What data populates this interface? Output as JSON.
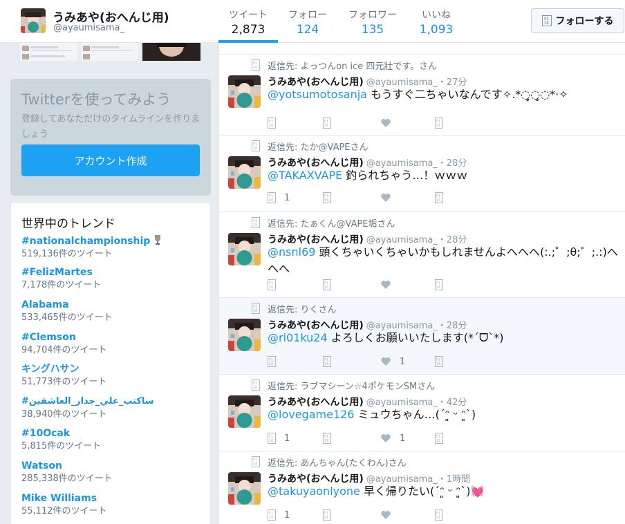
{
  "profile": {
    "name": "うみあや(おへんじ用)",
    "handle": "@ayaumisama_"
  },
  "stats": [
    {
      "label": "ツイート",
      "value": "2,873",
      "active": true
    },
    {
      "label": "フォロー",
      "value": "124",
      "active": false
    },
    {
      "label": "フォロワー",
      "value": "135",
      "active": false
    },
    {
      "label": "いいね",
      "value": "1,093",
      "active": false
    }
  ],
  "follow_button": {
    "label": "フォローする"
  },
  "signup": {
    "title": "Twitterを使ってみよう",
    "body": "登録してあなただけのタイムラインを作りましょう",
    "cta": "アカウント作成"
  },
  "trends": {
    "title": "世界中のトレンド",
    "items": [
      {
        "name": "#nationalchampionship",
        "count": "519,136件のツイート"
      },
      {
        "name": "#FelizMartes",
        "count": "7,178件のツイート"
      },
      {
        "name": "Alabama",
        "count": "533,465件のツイート"
      },
      {
        "name": "#Clemson",
        "count": "94,704件のツイート"
      },
      {
        "name": "キングハサン",
        "count": "51,773件のツイート"
      },
      {
        "name": "#ساكتب_علي_جدار_العاشقين",
        "count": "38,940件のツイート"
      },
      {
        "name": "#10Ocak",
        "count": "5,815件のツイート"
      },
      {
        "name": "Watson",
        "count": "285,338件のツイート"
      },
      {
        "name": "Mike Williams",
        "count": "55,112件のツイート"
      }
    ]
  },
  "tweets": [
    {
      "reply_to": "返信先: よっつんon ice 四元壯です。さん",
      "name": "うみあや(おへんじ用)",
      "meta": "@ayaumisama_・27分",
      "mention": "@yotsumotosanja",
      "text": " もうすぐ二ちゃいなんです✧.*◌̥̥◌̥̥◌*·✧",
      "replies": "",
      "likes": ""
    },
    {
      "reply_to": "返信先: たか@VAPEさん",
      "name": "うみあや(おへんじ用)",
      "meta": "@ayaumisama_・28分",
      "mention": "@TAKAXVAPE",
      "text": " 釣られちゃう…！ｗｗｗ",
      "replies": "1",
      "likes": ""
    },
    {
      "reply_to": "返信先: たぁくん@VAPE垢さん",
      "name": "うみあや(おへんじ用)",
      "meta": "@ayaumisama_・28分",
      "mention": "@nsnl69",
      "text": " 頭くちゃいくちゃいかもしれませんよへへへ(:.;゜;θ;゜;.:)へへへ",
      "replies": "",
      "likes": ""
    },
    {
      "reply_to": "返信先: りくさん",
      "name": "うみあや(おへんじ用)",
      "meta": "@ayaumisama_・28分",
      "mention": "@ri01ku24",
      "text": " よろしくお願いいたします(*ˊᗜˋ*)",
      "replies": "",
      "likes": "1"
    },
    {
      "reply_to": "返信先: ラブマシーン☆4ポケモンSMさん",
      "name": "うみあや(おへんじ用)",
      "meta": "@ayaumisama_・42分",
      "mention": "@lovegame126",
      "text": " ミュウちゃん…(´ᵔ͈ ᵕ ᵔ͈`)",
      "replies": "1",
      "likes": "1"
    },
    {
      "reply_to": "返信先: あんちゃん(たくわん)さん",
      "name": "うみあや(おへんじ用)",
      "meta": "@ayaumisama_・1時間",
      "mention": "@takuyaonlyone",
      "text": " 早く帰りたい(´ᵔ͈ ᵕ ᵔ͈`)💓",
      "replies": "1",
      "likes": ""
    }
  ]
}
